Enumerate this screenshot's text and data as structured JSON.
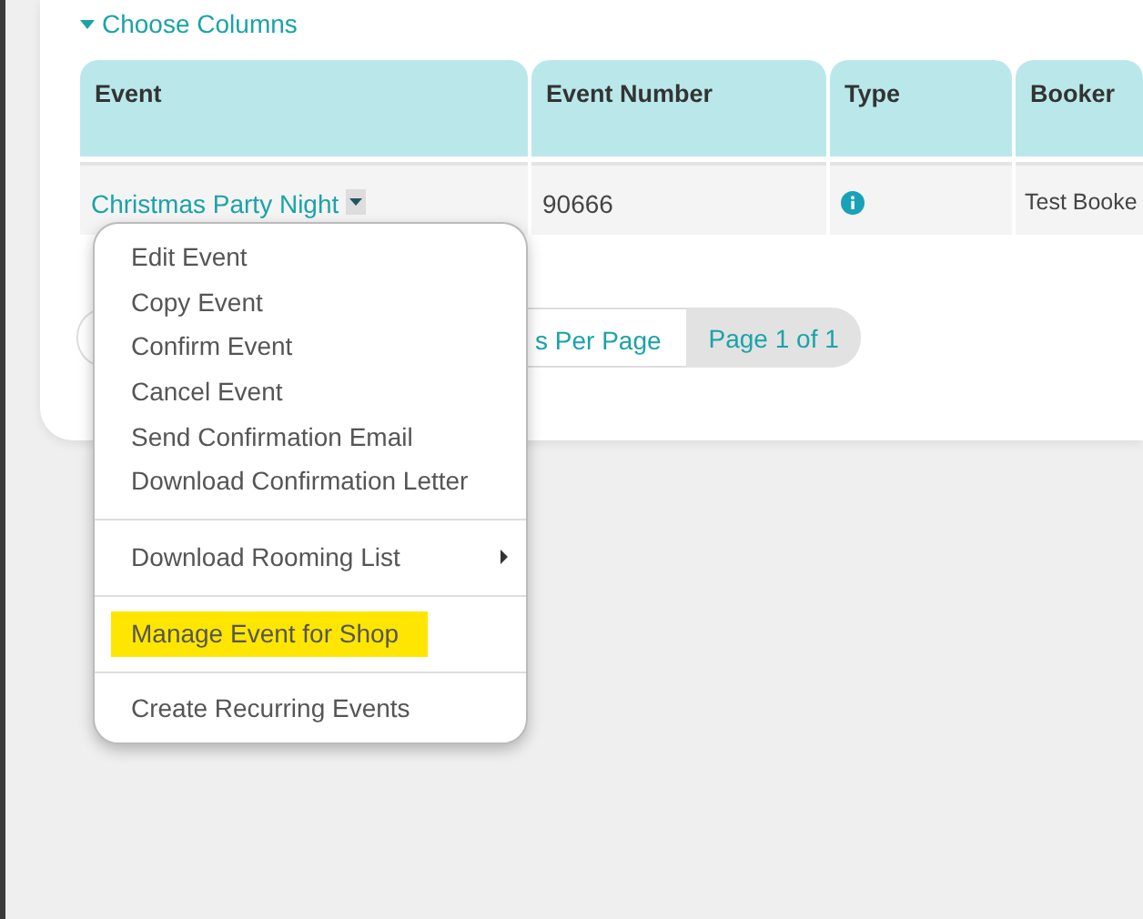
{
  "choose_columns": {
    "label": "Choose Columns",
    "expanded": true
  },
  "table": {
    "columns": [
      "Event",
      "Event Number",
      "Type",
      "Booker"
    ],
    "rows": [
      {
        "event": "Christmas Party Night",
        "event_number": "90666",
        "booker": "Test Booke"
      }
    ]
  },
  "pager": {
    "per_page": "s Per Page",
    "page": "Page 1 of 1"
  },
  "menu": {
    "groups": [
      [
        {
          "label": "Edit Event",
          "submenu": false,
          "highlighted": false
        },
        {
          "label": "Copy Event",
          "submenu": false,
          "highlighted": false
        },
        {
          "label": "Confirm Event",
          "submenu": false,
          "highlighted": false
        },
        {
          "label": "Cancel Event",
          "submenu": false,
          "highlighted": false
        },
        {
          "label": "Send Confirmation Email",
          "submenu": false,
          "highlighted": false
        },
        {
          "label": "Download Confirmation Letter",
          "submenu": false,
          "highlighted": false
        }
      ],
      [
        {
          "label": "Download Rooming List",
          "submenu": true,
          "highlighted": false
        }
      ],
      [
        {
          "label": "Manage Event for Shop",
          "submenu": false,
          "highlighted": true
        }
      ],
      [
        {
          "label": "Create Recurring Events",
          "submenu": false,
          "highlighted": false
        }
      ]
    ]
  }
}
